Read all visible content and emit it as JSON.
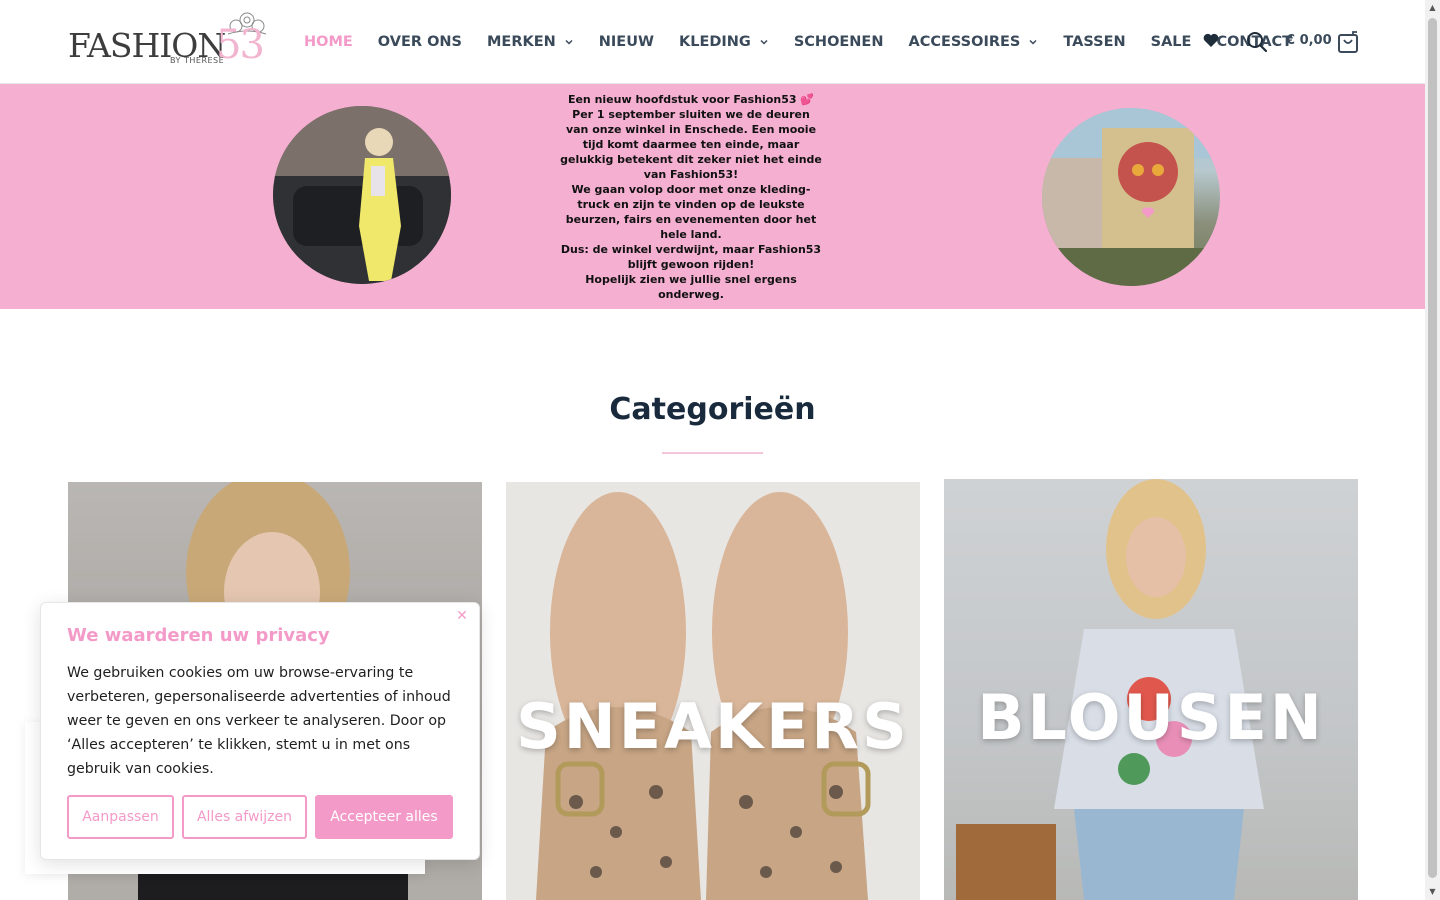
{
  "header": {
    "logo": {
      "main": "FASHION",
      "number": "53",
      "sub": "BY THERESE"
    },
    "nav": [
      {
        "label": "HOME",
        "dropdown": false,
        "active": true
      },
      {
        "label": "OVER ONS",
        "dropdown": false,
        "active": false
      },
      {
        "label": "MERKEN",
        "dropdown": true,
        "active": false
      },
      {
        "label": "NIEUW",
        "dropdown": false,
        "active": false
      },
      {
        "label": "KLEDING",
        "dropdown": true,
        "active": false
      },
      {
        "label": "SCHOENEN",
        "dropdown": false,
        "active": false
      },
      {
        "label": "ACCESSOIRES",
        "dropdown": true,
        "active": false
      },
      {
        "label": "TASSEN",
        "dropdown": false,
        "active": false
      },
      {
        "label": "SALE",
        "dropdown": false,
        "active": false
      },
      {
        "label": "CONTACT",
        "dropdown": false,
        "active": false
      }
    ],
    "icons": {
      "wishlist": "heart-icon",
      "search": "search-icon",
      "cart": "shopping-bag-icon"
    },
    "cart_total": "€ 0,00"
  },
  "hero": {
    "lines": [
      "Een nieuw hoofdstuk voor Fashion53 💕",
      "Per 1 september sluiten we de deuren van onze winkel in Enschede. Een mooie tijd komt daarmee ten einde, maar gelukkig betekent dit zeker niet het einde van Fashion53!",
      "We gaan volop door met onze kleding-truck en zijn te vinden op de leukste beurzen, fairs en evenementen door het hele land.",
      "Dus: de winkel verdwijnt, maar Fashion53 blijft gewoon rijden!",
      "Hopelijk zien we jullie snel ergens onderweg."
    ]
  },
  "categories": {
    "title": "Categorieën",
    "tiles": [
      {
        "label": ""
      },
      {
        "label": "SNEAKERS"
      },
      {
        "label": "BLOUSEN"
      }
    ]
  },
  "cookie": {
    "title": "We waarderen uw privacy",
    "body": "We gebruiken cookies om uw browse-ervaring te verbeteren, gepersonaliseerde advertenties of inhoud weer te geven en ons verkeer te analyseren. Door op ‘Alles accepteren’ te klikken, stemt u in met ons gebruik van cookies.",
    "buttons": {
      "customize": "Aanpassen",
      "reject": "Alles afwijzen",
      "accept": "Accepteer alles"
    },
    "close_icon": "close-icon"
  },
  "colors": {
    "accent": "#f39ac8",
    "hero_bg": "#f4afd1",
    "heading": "#192a3d",
    "nav_text": "#3a4a5a"
  }
}
